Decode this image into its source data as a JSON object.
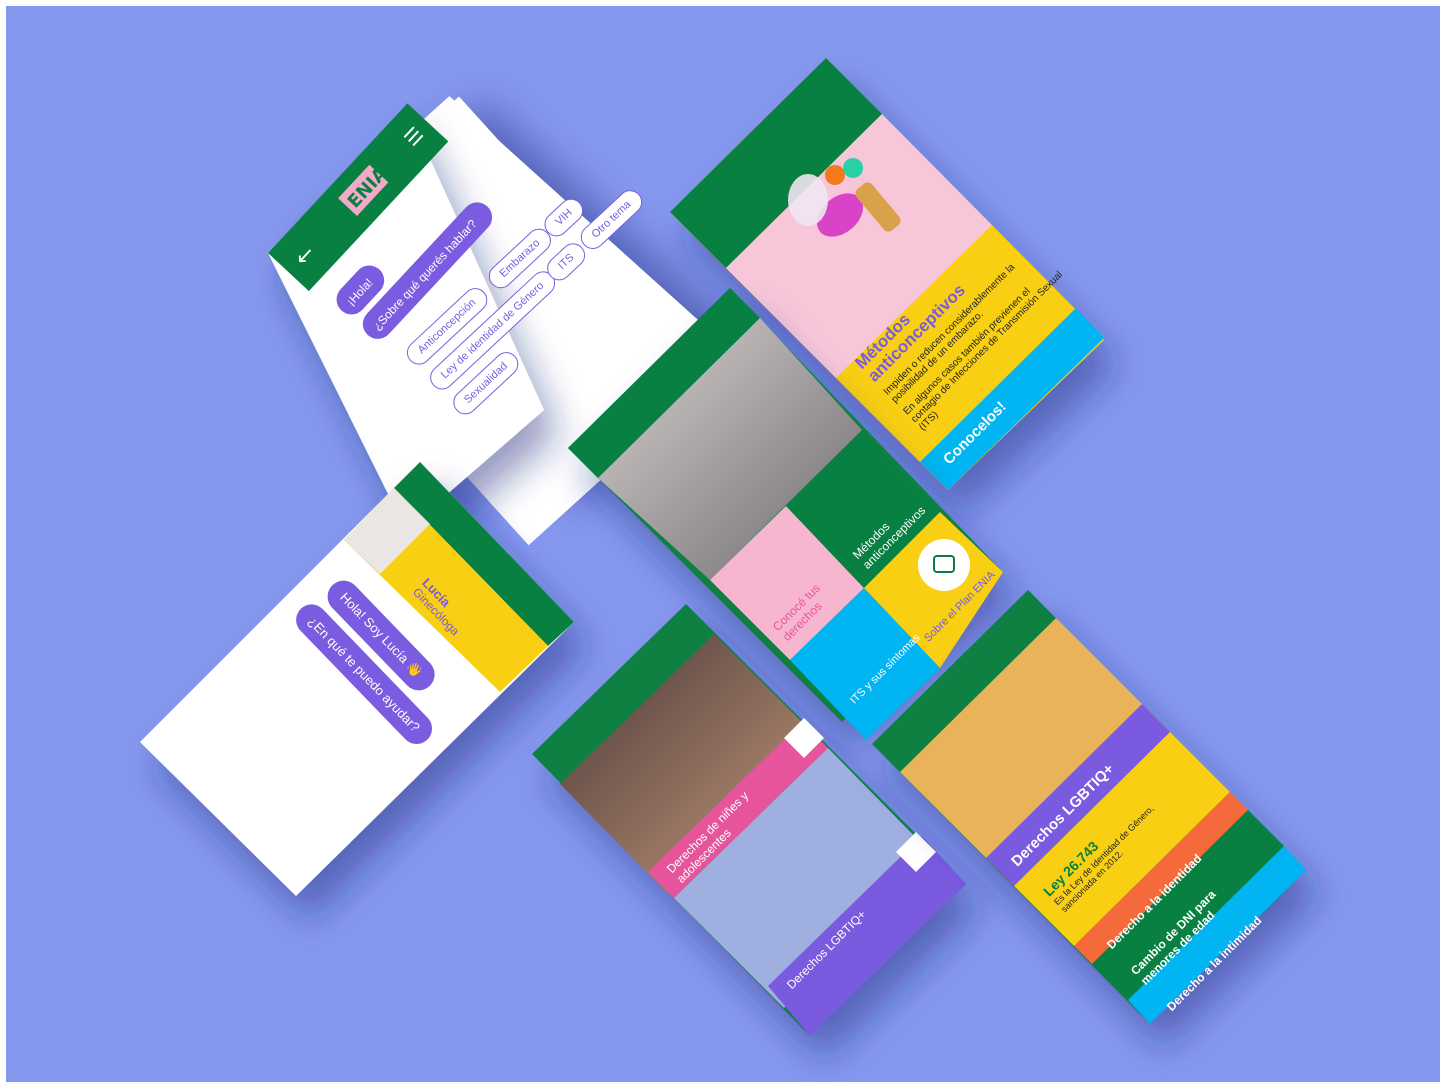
{
  "logo": "ENIA",
  "chat": {
    "greeting": "¡Hola!",
    "question": "¿Sobre qué querés hablar?",
    "topics": [
      "Anticoncepción",
      "Embarazo",
      "VIH",
      "Ley de identidad de Género",
      "ITS",
      "Otro tema",
      "Sexualidad"
    ]
  },
  "lucia": {
    "name": "Lucía",
    "role": "Ginecóloga",
    "msg1": "Hola! Soy Lucía 👋",
    "msg2": "¿En qué te puedo ayudar?"
  },
  "methods": {
    "title": "Métodos anticonceptivos",
    "p1": "Impiden o reducen considerablemente la posibilidad de un embarazo.",
    "p2": "En algunos casos también previenen el contagio de Infecciones de Transmisión Sexual (ITS)",
    "cta": "Conocelos!"
  },
  "home": {
    "tile_methods": "Métodos anticonceptivos",
    "tile_rights": "Conocé tus derechos",
    "tile_plan": "Sobre el Plan ENIA",
    "tile_its": "ITS y sus síntomas"
  },
  "rights": {
    "item1": "Derechos de niñes y adolescentes",
    "item2": "Derechos LGBTIQ+"
  },
  "lgbtiq": {
    "title": "Derechos LGBTIQ+",
    "law": "Ley 26.743",
    "law_desc": "Es la Ley de Identidad de Género, sancionada en 2012.",
    "item1": "Derecho a la identidad",
    "item2": "Cambio de DNI para menores de edad",
    "item3": "Derecho a la intimidad"
  },
  "colors": {
    "background": "#8698ee",
    "green": "#078042",
    "yellow": "#f8cf12",
    "purple": "#7a5adf",
    "pink": "#f7b6cf",
    "blue": "#00b5f2",
    "orange": "#f46a3a"
  }
}
